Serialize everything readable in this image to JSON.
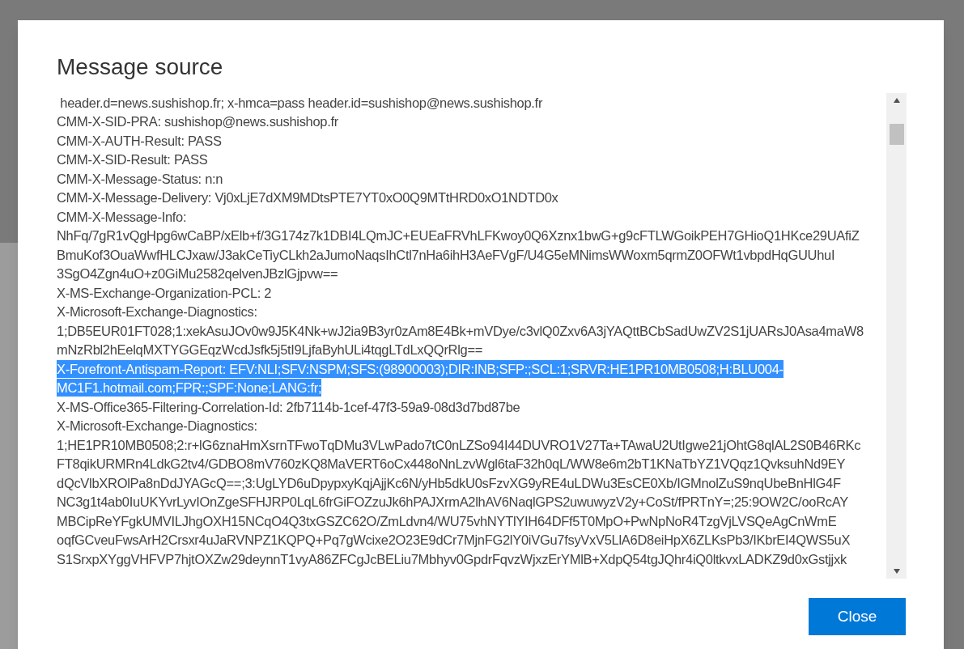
{
  "dialog": {
    "title": "Message source",
    "lines": [
      {
        "text": " header.d=news.sushishop.fr; x-hmca=pass header.id=sushishop@news.sushishop.fr",
        "selected": false
      },
      {
        "text": "CMM-X-SID-PRA: sushishop@news.sushishop.fr",
        "selected": false
      },
      {
        "text": "CMM-X-AUTH-Result: PASS",
        "selected": false
      },
      {
        "text": "CMM-X-SID-Result: PASS",
        "selected": false
      },
      {
        "text": "CMM-X-Message-Status: n:n",
        "selected": false
      },
      {
        "text": "CMM-X-Message-Delivery: Vj0xLjE7dXM9MDtsPTE7YT0xO0Q9MTtHRD0xO1NDTD0x",
        "selected": false
      },
      {
        "text": "CMM-X-Message-Info:",
        "selected": false
      },
      {
        "text": "NhFq/7gR1vQgHpg6wCaBP/xElb+f/3G174z7k1DBI4LQmJC+EUEaFRVhLFKwoy0Q6Xznx1bwG+g9cFTLWGoikPEH7GHioQ1HKce29UAfiZ",
        "selected": false
      },
      {
        "text": "BmuKof3OuaWwfHLCJxaw/J3akCeTiyCLkh2aJumoNaqsIhCtl7nHa6ihH3AeFVgF/U4G5eMNimsWWoxm5qrmZ0OFWt1vbpdHqGUUhuI",
        "selected": false
      },
      {
        "text": "3SgO4Zgn4uO+z0GiMu2582qelvenJBzlGjpvw==",
        "selected": false
      },
      {
        "text": "X-MS-Exchange-Organization-PCL: 2",
        "selected": false
      },
      {
        "text": "X-Microsoft-Exchange-Diagnostics:",
        "selected": false
      },
      {
        "text": "1;DB5EUR01FT028;1:xekAsuJOv0w9J5K4Nk+wJ2ia9B3yr0zAm8E4Bk+mVDye/c3vlQ0Zxv6A3jYAQttBCbSadUwZV2S1jUARsJ0Asa4maW8",
        "selected": false
      },
      {
        "text": "mNzRbl2hEelqMXTYGGEqzWcdJsfk5j5tI9LjfaByhULi4tqgLTdLxQQrRlg==",
        "selected": false
      },
      {
        "text": "X-Forefront-Antispam-Report: EFV:NLI;SFV:NSPM;SFS:(98900003);DIR:INB;SFP:;SCL:1;SRVR:HE1PR10MB0508;H:BLU004-",
        "selected": true
      },
      {
        "text": "MC1F1.hotmail.com;FPR:;SPF:None;LANG:fr;",
        "selected": true
      },
      {
        "text": "X-MS-Office365-Filtering-Correlation-Id: 2fb7114b-1cef-47f3-59a9-08d3d7bd87be",
        "selected": false
      },
      {
        "text": "X-Microsoft-Exchange-Diagnostics:",
        "selected": false
      },
      {
        "text": "1;HE1PR10MB0508;2:r+lG6znaHmXsrnTFwoTqDMu3VLwPado7tC0nLZSo94I44DUVRO1V27Ta+TAwaU2UtIgwe21jOhtG8qlAL2S0B46RKc",
        "selected": false
      },
      {
        "text": "FT8qikURMRn4LdkG2tv4/GDBO8mV760zKQ8MaVERT6oCx448oNnLzvWgl6taF32h0qL/WW8e6m2bT1KNaTbYZ1VQqz1QvksuhNd9EY",
        "selected": false
      },
      {
        "text": "dQcVlbXROlPa8nDdJYAGcQ==;3:UgLYD6uDpypxyKqjAjjKc6N/yHb5dkU0sFzvXG9yRE4uLDWu3EsCE0Xb/IGMnolZuS9nqUbeBnHlG4F",
        "selected": false
      },
      {
        "text": "NC3g1t4ab0IuUKYvrLyvIOnZgeSFHJRP0LqL6frGiFOZzuJk6hPAJXrmA2lhAV6NaqlGPS2uwuwyzV2y+CoSt/fPRTnY=;25:9OW2C/ooRcAY",
        "selected": false
      },
      {
        "text": "MBCipReYFgkUMVILJhgOXH15NCqO4Q3txGSZC62O/ZmLdvn4/WU75vhNYTlYIH64DFf5T0MpO+PwNpNoR4TzgVjLVSQeAgCnWmE",
        "selected": false
      },
      {
        "text": "oqfGCveuFwsArH2Crsxr4uJaRVNPZ1KQPQ+Pq7gWcixe2O23E9dCr7MjnFG2lY0iVGu7fsyVxV5LlA6D8eiHpX6ZLKsPb3/IKbrEI4QWS5uX",
        "selected": false
      },
      {
        "text": "S1SrxpXYggVHFVP7hjtOXZw29deynnT1vyA86ZFCgJcBELiu7Mbhyv0GpdrFqvzWjxzErYMlB+XdpQ54tgJQhr4iQ0ltkvxLADKZ9d0xGstjjxk",
        "selected": false
      }
    ],
    "close_button": "Close"
  }
}
